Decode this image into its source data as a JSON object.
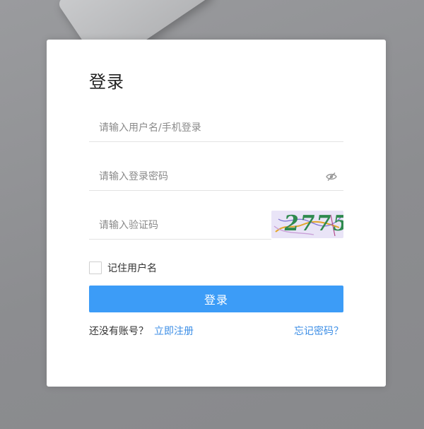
{
  "login": {
    "title": "登录",
    "username_placeholder": "请输入用户名/手机登录",
    "password_placeholder": "请输入登录密码",
    "captcha_placeholder": "请输入验证码",
    "captcha_text": "2775",
    "remember_label": "记住用户名",
    "submit_label": "登录",
    "no_account_text": "还没有账号？",
    "register_link": "立即注册",
    "forgot_link": "忘记密码？"
  },
  "colors": {
    "primary": "#3c9cf7",
    "link": "#3c8ee6",
    "overlay": "#8f9093"
  },
  "icons": {
    "password_toggle": "eye-slash-icon"
  }
}
